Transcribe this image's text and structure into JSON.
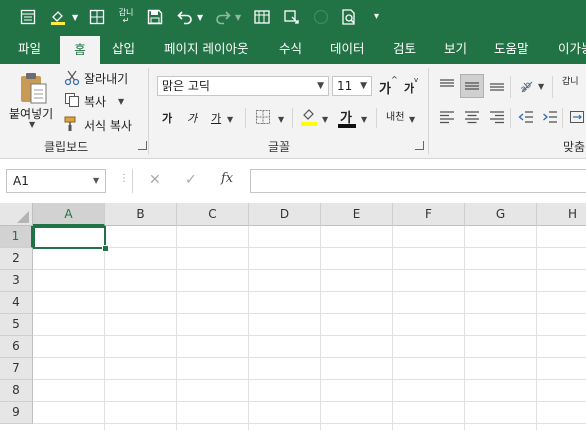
{
  "ribbon_tabs": [
    "파일",
    "홈",
    "삽입",
    "페이지 레이아웃",
    "수식",
    "데이터",
    "검토",
    "보기",
    "도움말",
    "이가능"
  ],
  "active_tab": "홈",
  "clipboard": {
    "paste_label": "붙여넣기",
    "cut_label": "잘라내기",
    "copy_label": "복사",
    "format_painter_label": "서식 복사",
    "group_label": "클립보드"
  },
  "font": {
    "font_name": "맑은 고딕",
    "font_size": "11",
    "grow_font": "가",
    "shrink_font": "가",
    "bold": "가",
    "italic": "가",
    "underline": "가",
    "font_color_glyph": "가",
    "phonetic_glyph": "내천",
    "group_label": "글꼴"
  },
  "alignment": {
    "orientation_glyph": "ab",
    "wrap_glyph": "갑니",
    "group_label": "맞춤"
  },
  "formula_bar": {
    "name_box": "A1",
    "cancel_glyph": "✕",
    "enter_glyph": "✓",
    "fx_label": "fx",
    "formula": ""
  },
  "sheet": {
    "columns": [
      "A",
      "B",
      "C",
      "D",
      "E",
      "F",
      "G",
      "H"
    ],
    "rows": [
      "1",
      "2",
      "3",
      "4",
      "5",
      "6",
      "7",
      "8",
      "9"
    ],
    "selected_cell": "A1"
  },
  "colors": {
    "excel_green": "#217346",
    "annotation_red": "#e51b1b"
  },
  "icons": [
    "save-icon",
    "undo-icon",
    "redo-icon",
    "form-icon",
    "touch-mode-icon",
    "filter-icon",
    "print-preview-icon",
    "customize-qat-icon",
    "paste-icon",
    "cut-icon",
    "copy-icon",
    "format-painter-icon",
    "border-icon",
    "fill-color-icon",
    "font-color-icon",
    "align-top-icon",
    "align-middle-icon",
    "align-bottom-icon",
    "align-left-icon",
    "align-center-icon",
    "align-right-icon",
    "decrease-indent-icon",
    "increase-indent-icon",
    "fx-icon"
  ]
}
